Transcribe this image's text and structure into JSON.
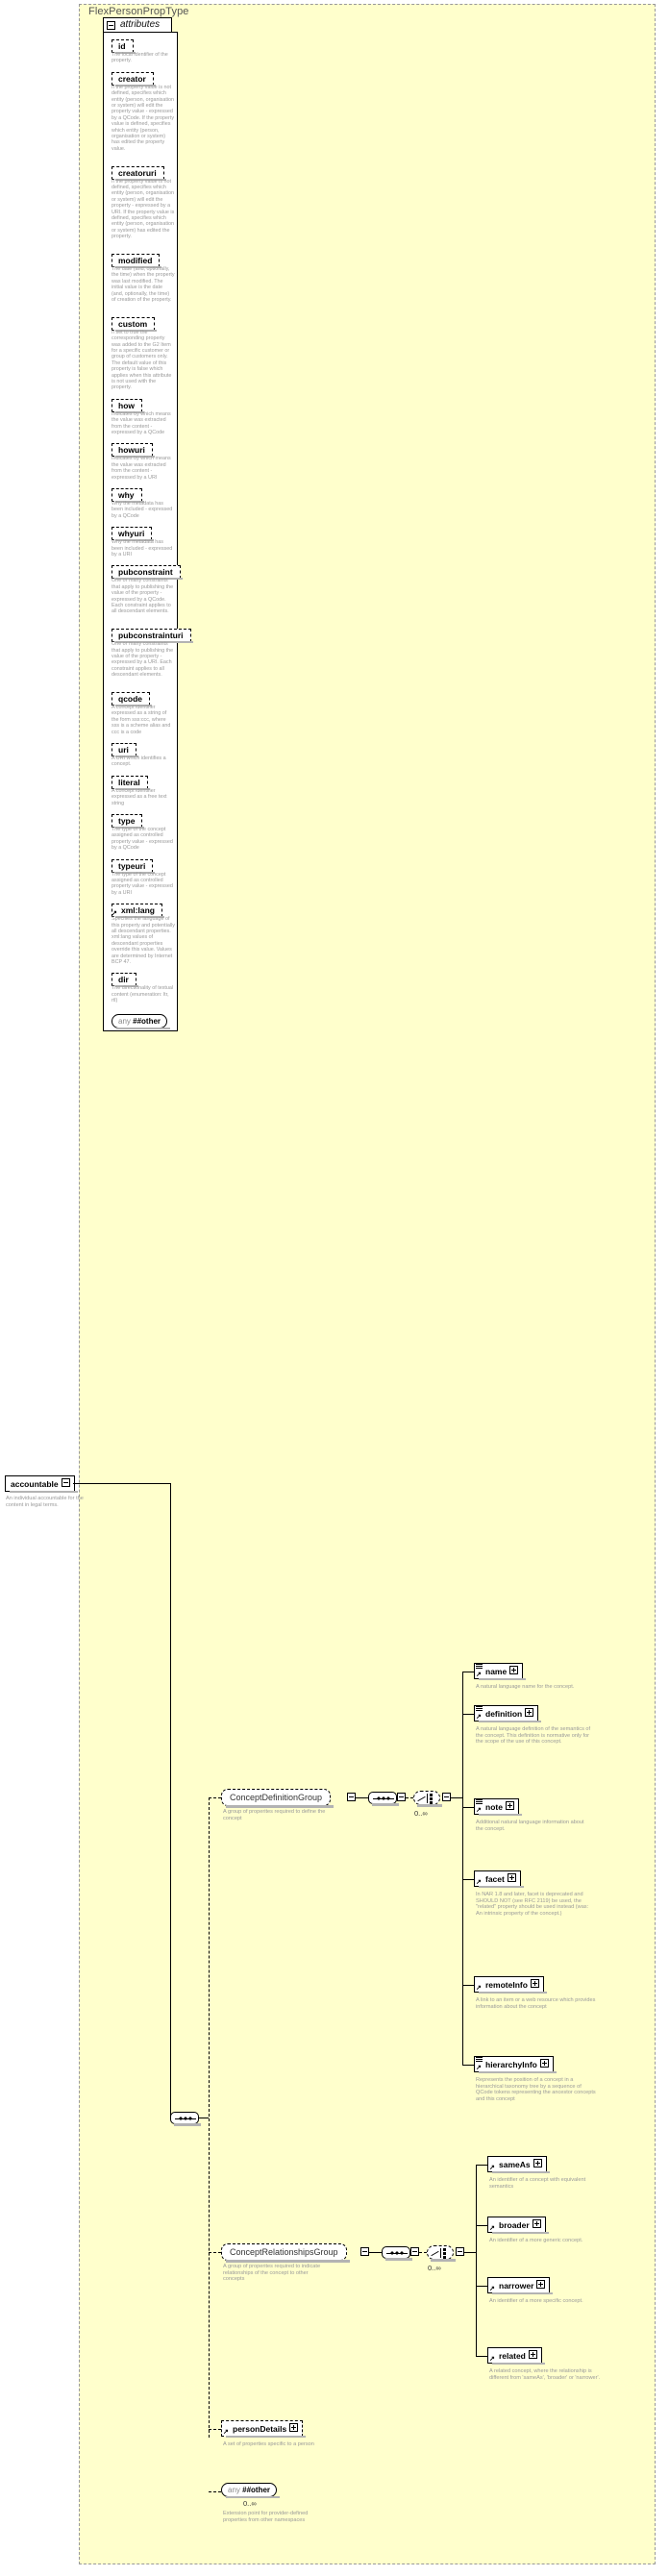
{
  "diagram": {
    "title": "FlexPersonPropType",
    "attributes_tab_label": "attributes"
  },
  "attributes": [
    {
      "name": "id",
      "desc": "The local identifier of the property."
    },
    {
      "name": "creator",
      "desc": "If the property value is not defined, specifies which entity (person, organisation or system) will edit the property value - expressed by a QCode. If the property value is defined, specifies which entity (person, organisation or system) has edited the property value."
    },
    {
      "name": "creatoruri",
      "desc": "If the property value is not defined, specifies which entity (person, organisation or system) will edit the property - expressed by a URI. If the property value is defined, specifies which entity (person, organisation or system) has edited the property."
    },
    {
      "name": "modified",
      "desc": "The date (and, optionally, the time) when the property was last modified. The initial value is the date (and, optionally, the time) of creation of the property."
    },
    {
      "name": "custom",
      "desc": "If set to true the corresponding property was added to the G2 Item for a specific customer or group of customers only. The default value of this property is false which applies when this attribute is not used with the property."
    },
    {
      "name": "how",
      "desc": "Indicates by which means the value was extracted from the content - expressed by a QCode"
    },
    {
      "name": "howuri",
      "desc": "Indicates by which means the value was extracted from the content - expressed by a URI"
    },
    {
      "name": "why",
      "desc": "Why the metadata has been included - expressed by a QCode"
    },
    {
      "name": "whyuri",
      "desc": "Why the metadata has been included - expressed by a URI"
    },
    {
      "name": "pubconstraint",
      "desc": "One or many constraints that apply to publishing the value of the property - expressed by a QCode. Each constraint applies to all descendant elements."
    },
    {
      "name": "pubconstrainturi",
      "desc": "One or many constraints that apply to publishing the value of the property - expressed by a URI. Each constraint applies to all descendant elements."
    },
    {
      "name": "qcode",
      "desc": "A concept identifier expressed as a string of the form sss:ccc, where sss is a scheme alias and ccc is a code"
    },
    {
      "name": "uri",
      "desc": "A URI which identifies a concept."
    },
    {
      "name": "literal",
      "desc": "A concept identifier expressed as a free text string"
    },
    {
      "name": "type",
      "desc": "The type of the concept assigned as controlled property value - expressed by a QCode"
    },
    {
      "name": "typeuri",
      "desc": "The type of the concept assigned as controlled property value - expressed by a URI"
    },
    {
      "name": "xml:lang",
      "desc": "Specifies the language of this property and potentially all descendant properties. xml:lang values of descendant properties override this value. Values are determined by Internet BCP 47."
    },
    {
      "name": "dir",
      "desc": "The directionality of textual content (enumeration: ltr, rtl)"
    }
  ],
  "attributes_any": {
    "any_label": "any",
    "ns_label": "##other"
  },
  "root_element": {
    "name": "accountable",
    "desc": "An individual accountable for the content in legal terms.",
    "toggle": "minus"
  },
  "groups": [
    {
      "id": "concept-definition-group",
      "name": "ConceptDefinitionGroup",
      "desc": "A group of properites required to define the concept",
      "occurs": "0..∞",
      "children": [
        {
          "name": "name",
          "desc": "A natural language name for the concept.",
          "toggle": "plus",
          "seq": true
        },
        {
          "name": "definition",
          "desc": "A natural language definition of the semantics of the concept. This definition is normative only for the scope of the use of this concept.",
          "toggle": "plus",
          "seq": true
        },
        {
          "name": "note",
          "desc": "Additional natural language information about the concept.",
          "toggle": "plus",
          "seq": true
        },
        {
          "name": "facet",
          "desc": "In NAR 1.8 and later, facet is deprecated and SHOULD NOT (see RFC 2119) be used, the \"related\" property should be used instead (was: An intrinsic property of the concept.)",
          "toggle": "plus",
          "seq": false
        },
        {
          "name": "remoteInfo",
          "desc": "A link to an item or a web resource which provides information about the concept",
          "toggle": "plus",
          "seq": false
        },
        {
          "name": "hierarchyInfo",
          "desc": "Represents the position of a concept in a hierarchical taxonomy tree by a sequence of QCode tokens representing the ancestor concepts and this concept",
          "toggle": "plus",
          "seq": true
        }
      ]
    },
    {
      "id": "concept-relationships-group",
      "name": "ConceptRelationshipsGroup",
      "desc": "A group of properites required to indicate relationships of the concept to other concepts",
      "occurs": "0..∞",
      "children": [
        {
          "name": "sameAs",
          "desc": "An identifier of a concept with equivalent semantics",
          "toggle": "plus",
          "seq": false
        },
        {
          "name": "broader",
          "desc": "An identifier of a more generic concept.",
          "toggle": "plus",
          "seq": false
        },
        {
          "name": "narrower",
          "desc": "An identifier of a more specific concept.",
          "toggle": "plus",
          "seq": false
        },
        {
          "name": "related",
          "desc": "A related concept, where the relationship is different from 'sameAs', 'broader' or 'narrower'.",
          "toggle": "plus",
          "seq": false
        }
      ]
    }
  ],
  "person_details": {
    "name": "personDetails",
    "desc": "A set of properties specific to a person",
    "toggle": "plus"
  },
  "content_any": {
    "any_label": "any",
    "ns_label": "##other",
    "occurs": "0..∞",
    "desc": "Extension point for provider-defined properties from other namespaces"
  },
  "colors": {
    "panel_bg": "#ffffcc",
    "box_bg": "#ffffff",
    "line": "#000000",
    "desc_text": "#9a9a9a",
    "shadow": "#b3b3b3"
  }
}
